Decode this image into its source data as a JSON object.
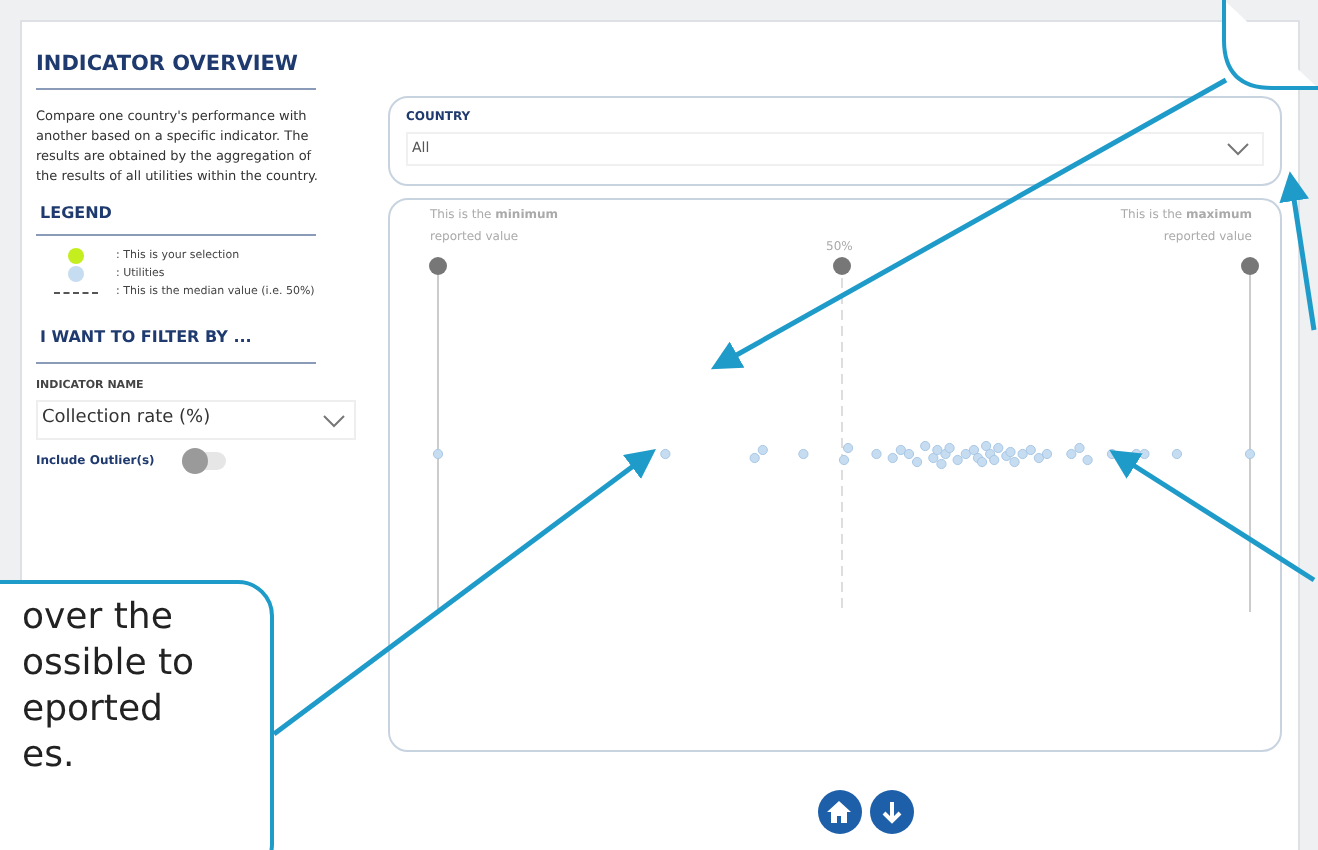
{
  "sidebar": {
    "title": "INDICATOR OVERVIEW",
    "description": "Compare one country's performance with another based on a specific indicator. The results are obtained by the aggregation of the results of all utilities within the country.",
    "legend": {
      "title": "LEGEND",
      "items": [
        {
          "kind": "dot",
          "color": "#c5ee1e",
          "label": ": This is your selection"
        },
        {
          "kind": "dot",
          "color": "#c6dcf0",
          "label": ": Utilities"
        },
        {
          "kind": "dash",
          "label": ": This is the median value (i.e. 50%)"
        }
      ]
    },
    "filter_title": "I WANT TO FILTER BY ...",
    "indicator": {
      "label": "INDICATOR NAME",
      "value": "Collection rate (%)"
    },
    "outlier_toggle": {
      "label": "Include Outlier(s)",
      "on": false
    }
  },
  "country": {
    "label": "COUNTRY",
    "value": "All"
  },
  "chart": {
    "min_label": "This is the **minimum**",
    "min_sub": "reported value",
    "median_label": "50%",
    "max_label": "This is the **maximum**",
    "max_sub": "reported value"
  },
  "nav_buttons": [
    {
      "kind": "home"
    },
    {
      "kind": "down"
    }
  ],
  "callouts": [
    {
      "lines": [
        "over the",
        "ossible to",
        "eported",
        "es."
      ]
    }
  ]
}
